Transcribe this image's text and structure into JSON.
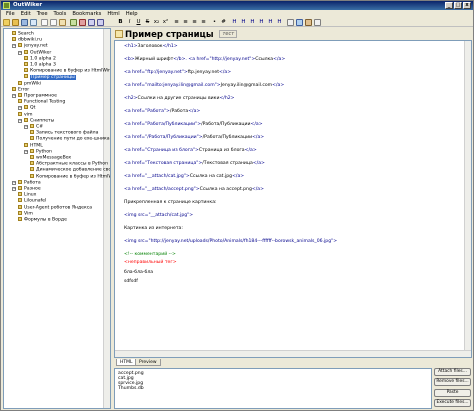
{
  "app": {
    "title": "OutWiker"
  },
  "window_controls": [
    "_",
    "□",
    "x"
  ],
  "menu": [
    "File",
    "Edit",
    "Tree",
    "Tools",
    "Bookmarks",
    "Html",
    "Help"
  ],
  "tree": {
    "items": [
      {
        "label": "Search"
      },
      {
        "label": "dbbwiki.ru"
      },
      {
        "label": "jenyay.net"
      },
      {
        "label": "OutWiker"
      },
      {
        "label": "1.0 alpha 2"
      },
      {
        "label": "1.0 alpha 3"
      },
      {
        "label": "Копирование в буфер из HtmlWindow"
      },
      {
        "label": "Пример страницы"
      },
      {
        "label": "pmWiki"
      },
      {
        "label": "Error"
      },
      {
        "label": "Программное"
      },
      {
        "label": "Functional Testing"
      },
      {
        "label": "Qt"
      },
      {
        "label": "vim"
      },
      {
        "label": "Сниппеты"
      },
      {
        "label": "C#"
      },
      {
        "label": "Запись текстового файла"
      },
      {
        "label": "Получение пути до exe-шника"
      },
      {
        "label": "HTML"
      },
      {
        "label": "Python"
      },
      {
        "label": "wxMessageBox"
      },
      {
        "label": "Абстрактные классы в Python"
      },
      {
        "label": "Динамическое добавление свойст"
      },
      {
        "label": "Копирование в буфер из HtmlWindo"
      },
      {
        "label": "Работа"
      },
      {
        "label": "Разное"
      },
      {
        "label": "Linux"
      },
      {
        "label": "Lilounafel"
      },
      {
        "label": "User-Agent роботов Яндекса"
      },
      {
        "label": "Vim"
      },
      {
        "label": "Формулы в Ворде"
      }
    ]
  },
  "page": {
    "title": "Пример страницы",
    "tag": "тест"
  },
  "editor": {
    "lines": [
      {
        "a": "<h1>",
        "b": "Заголовок",
        "c": "</h1>"
      },
      {
        "a": "<b>",
        "b": "Жирный шрифт",
        "c": "</b>. ",
        "d": "<a href=\"http://jenyay.net\">",
        "e": "Ссылка",
        "f": "</a>"
      },
      {
        "a": "<a href=\"ftp://jenyay.net\">",
        "b": "ftp.jenyay.net",
        "c": "</a>"
      },
      {
        "a": "<a href=\"mailto:jenyay.ilin@gmail.com\">",
        "b": "Jenyay.ilin@gmail.com",
        "c": "</a>"
      },
      {
        "a": "<h2>",
        "b": "Ссылки на другие страницы вики",
        "c": "</h2>"
      },
      {
        "a": "<a href=\"Работа\">",
        "b": "/Работа",
        "c": "</a>"
      },
      {
        "a": "<a href=\"Работа/Публикации\">",
        "b": "/Работа/Публикации",
        "c": "</a>"
      },
      {
        "a": "<a href=\"/Работа/Публикации\">",
        "b": "/Работа/Публикации",
        "c": "</a>"
      },
      {
        "a": "<a href=\"Страница из блога\">",
        "b": "Страница из блога",
        "c": "</a>"
      },
      {
        "a": "<a href=\"Текстовая страница\">",
        "b": "/Текстовая страница",
        "c": "</a>"
      },
      {
        "a": "<a href=\"__attach/cat.jpg\">",
        "b": "Ссылка на cat.jpg",
        "c": "</a>"
      },
      {
        "a": "<a href=\"__attach/accept.png\">",
        "b": "Ссылка на accept.png",
        "c": "</a>"
      },
      {
        "a": "",
        "b": "Прикрепленная к странице картинка:",
        "c": ""
      },
      {
        "a": "<img src=\"__attach/cat.jpg\">",
        "b": "",
        "c": ""
      },
      {
        "a": "",
        "b": "Картинка из интернета:",
        "c": ""
      },
      {
        "a": "<img src=\"http://jenyay.net/uploads/Photo/Animals/fh184---ffffff--borowsk_animals_06.jpg\">",
        "b": "",
        "c": ""
      },
      {
        "a": "",
        "b": "",
        "c": "",
        "comment": "<!-- комментарий -->"
      },
      {
        "a": "",
        "b": "",
        "c": "",
        "error": "<неправильный тег>"
      },
      {
        "a": "",
        "b": "бла-бла-бла",
        "c": ""
      },
      {
        "a": "",
        "b": "sdfsdf",
        "c": ""
      }
    ]
  },
  "tabs": [
    "HTML",
    "Preview"
  ],
  "attachments": [
    "accept.png",
    "cat.jpg",
    "sprvice.jpg",
    "Thumbs.db"
  ],
  "attach_buttons": [
    "Attach files...",
    "Remove files...",
    "Paste",
    "Execute files..."
  ]
}
